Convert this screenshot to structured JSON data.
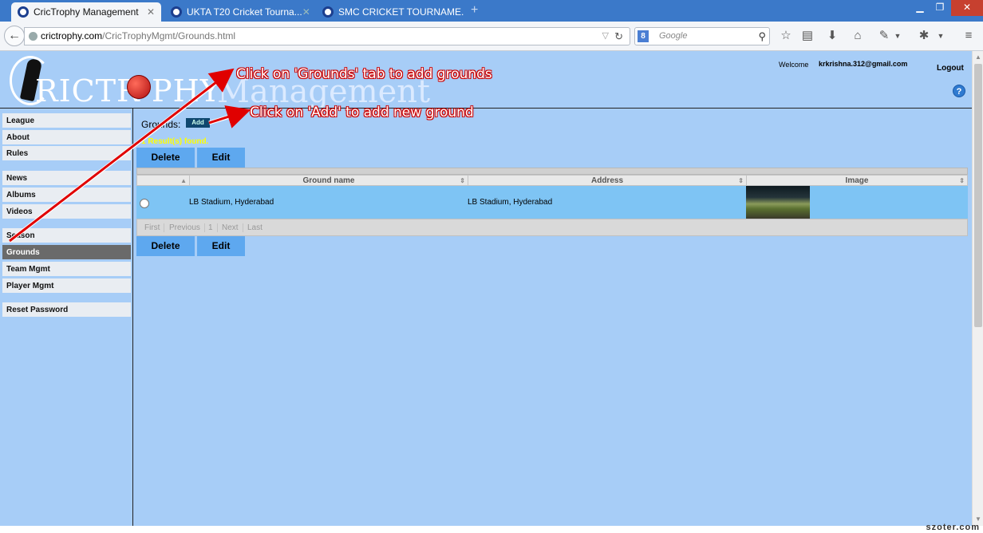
{
  "browser": {
    "tabs": [
      {
        "title": "CricTrophy Management",
        "active": true
      },
      {
        "title": "UKTA T20 Cricket Tourna...",
        "active": false
      },
      {
        "title": "SMC CRICKET TOURNAME...",
        "active": false
      }
    ],
    "new_tab": "+",
    "url_host": "crictrophy.com",
    "url_path": "/CricTrophyMgmt/Grounds.html",
    "search_placeholder": "Google",
    "search_engine_glyph": "8",
    "back_glyph": "←"
  },
  "header": {
    "logo_word": "RICTR",
    "logo_word2": "PHY",
    "logo_mgmt": "Management",
    "welcome": "Welcome",
    "user": "krkrishna.312@gmail.com",
    "logout": "Logout",
    "help": "?"
  },
  "sidebar": {
    "items": [
      {
        "label": "League"
      },
      {
        "label": "About"
      },
      {
        "label": "Rules"
      },
      {
        "label": "News"
      },
      {
        "label": "Albums"
      },
      {
        "label": "Videos"
      },
      {
        "label": "Season"
      },
      {
        "label": "Grounds"
      },
      {
        "label": "Team Mgmt"
      },
      {
        "label": "Player Mgmt"
      },
      {
        "label": "Reset Password"
      }
    ]
  },
  "content": {
    "section_label": "Grounds:",
    "add_label": "Add",
    "results_text": "1 Result(s) found.",
    "delete_label": "Delete",
    "edit_label": "Edit",
    "columns": [
      "Ground name",
      "Address",
      "Image"
    ],
    "rows": [
      {
        "ground_name": "LB Stadium, Hyderabad",
        "address": "LB Stadium, Hyderabad"
      }
    ],
    "pager": [
      "First",
      "Previous",
      "1",
      "Next",
      "Last"
    ]
  },
  "annotations": {
    "note1": "Click on 'Grounds' tab to add grounds",
    "note2": "Click on 'Add' to add new ground"
  },
  "watermark": "szoter.com",
  "colors": {
    "page_bg": "#a7cdf7",
    "tab_strip": "#3b79c9",
    "button": "#5ea8ef",
    "row_highlight": "#7ec4f4",
    "arrow": "#e00000"
  }
}
